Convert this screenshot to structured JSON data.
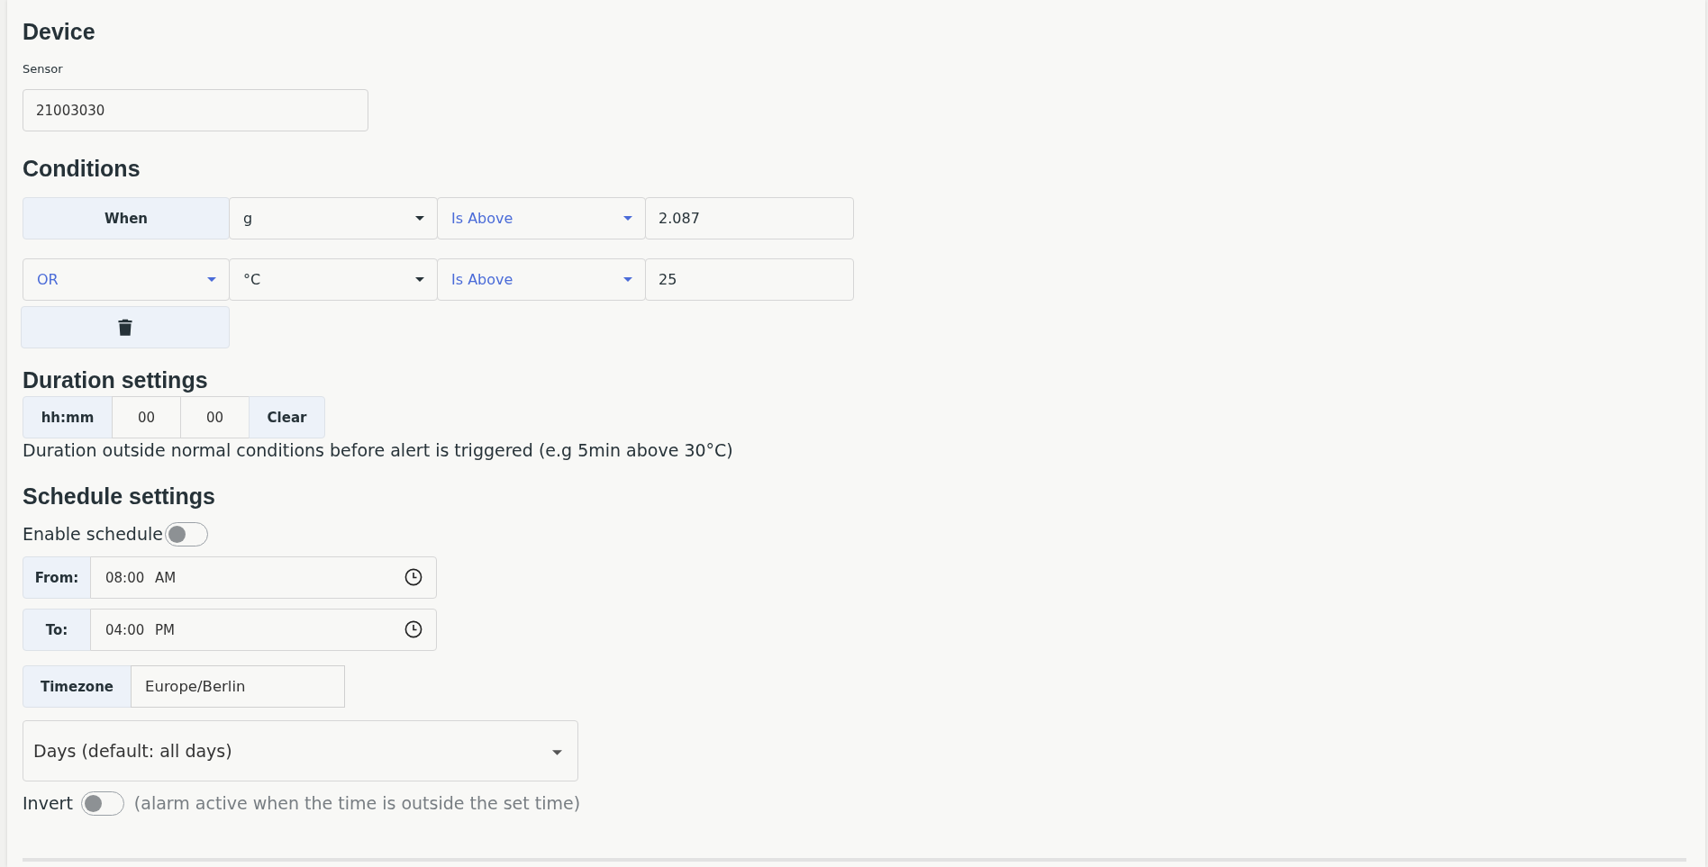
{
  "device": {
    "heading": "Device",
    "sensor_label": "Sensor",
    "sensor_value": "21003030"
  },
  "conditions": {
    "heading": "Conditions",
    "rows": [
      {
        "connector": {
          "kind": "label",
          "text": "When"
        },
        "unit": "g",
        "operator": "Is Above",
        "threshold": "2.087"
      },
      {
        "connector": {
          "kind": "select",
          "text": "OR"
        },
        "unit": "°C",
        "operator": "Is Above",
        "threshold": "25"
      }
    ]
  },
  "duration": {
    "heading": "Duration settings",
    "format_label": "hh:mm",
    "hours": "00",
    "minutes": "00",
    "clear_button": "Clear",
    "hint": "Duration outside normal conditions before alert is triggered (e.g 5min above 30°C)"
  },
  "schedule": {
    "heading": "Schedule settings",
    "enable": {
      "label": "Enable schedule",
      "on": false
    },
    "from": {
      "label": "From:",
      "value": "08:00 AM"
    },
    "to": {
      "label": "To:",
      "value": "04:00 PM"
    },
    "timezone": {
      "label": "Timezone",
      "value": "Europe/Berlin"
    },
    "days": {
      "placeholder": "Days (default: all days)"
    },
    "invert": {
      "label": "Invert",
      "on": false,
      "note": "(alarm active when the time is outside the set time)"
    }
  }
}
